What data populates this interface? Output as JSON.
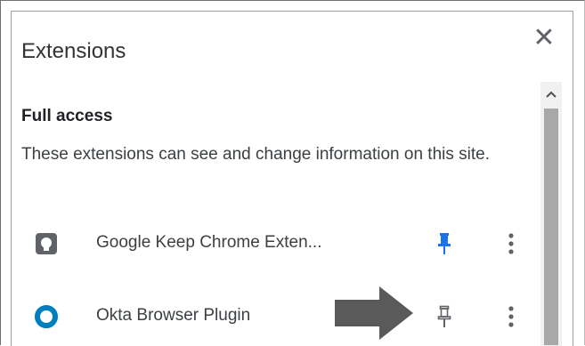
{
  "popup": {
    "title": "Extensions",
    "close_label": "✕"
  },
  "section": {
    "heading": "Full access",
    "description": "These extensions can see and change information on this site."
  },
  "extensions": [
    {
      "name": "Google Keep Chrome Exten...",
      "icon": "google-keep-icon",
      "pinned": true
    },
    {
      "name": "Okta Browser Plugin",
      "icon": "okta-icon",
      "pinned": false
    }
  ],
  "colors": {
    "pinned": "#1a73e8",
    "unpinned": "#5f6368",
    "okta": "#007dc1",
    "keep_icon": "#5f6368",
    "arrow": "#5a5a5a"
  }
}
